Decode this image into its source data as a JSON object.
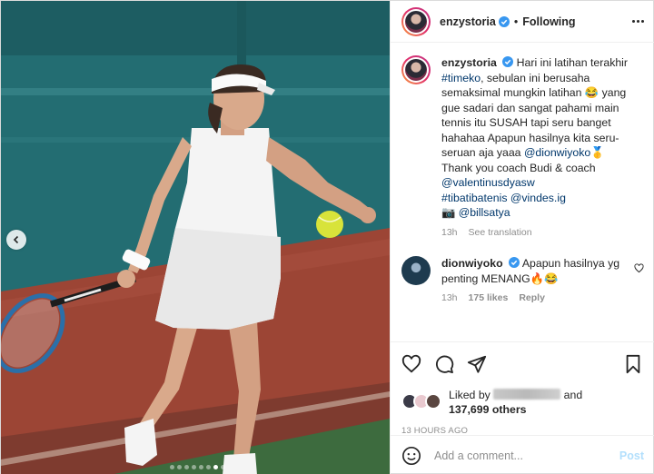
{
  "post": {
    "author": "enzystoria",
    "following_label": "Following",
    "separator": "•"
  },
  "caption": {
    "username": "enzystoria",
    "line1": "Hari ini latihan terakhir",
    "hashtag_timeko": "#timeko",
    "line2": ", sebulan ini berusaha semaksimal mungkin latihan 😂 yang gue sadari dan sangat pahami main tennis itu SUSAH tapi seru banget hahahaa Apapun hasilnya kita seru-seruan aja yaaa ",
    "mention_dion": "@dionwiyoko",
    "medal": "🥇",
    "thanks": "Thank you coach Budi & coach",
    "mention_valentinus": "@valentinusdyasw",
    "hashtag_tibatibatenis": "#tibatibatenis",
    "mention_vindes": "@vindes.ig",
    "camera": "📷",
    "mention_bills": "@billsatya",
    "time": "13h",
    "see_translation": "See translation"
  },
  "comment": {
    "username": "dionwiyoko",
    "text": "Apapun hasilnya yg penting MENANG🔥😂",
    "time": "13h",
    "likes": "175 likes",
    "reply": "Reply"
  },
  "likes": {
    "prefix": "Liked by",
    "and": "and",
    "count": "137,699 others"
  },
  "timestamp": "13 HOURS AGO",
  "add_comment": {
    "placeholder": "Add a comment...",
    "post_label": "Post"
  },
  "carousel": {
    "total": 8,
    "active_index": 6
  },
  "colors": {
    "verified": "#3897f0",
    "link": "#00376b",
    "muted": "#8e8e8e",
    "post_button": "#b2dffc"
  },
  "icons": [
    "chevron-left-icon",
    "verified-icon",
    "more-icon",
    "heart-icon",
    "comment-icon",
    "share-icon",
    "bookmark-icon",
    "emoji-icon",
    "camera-icon"
  ]
}
